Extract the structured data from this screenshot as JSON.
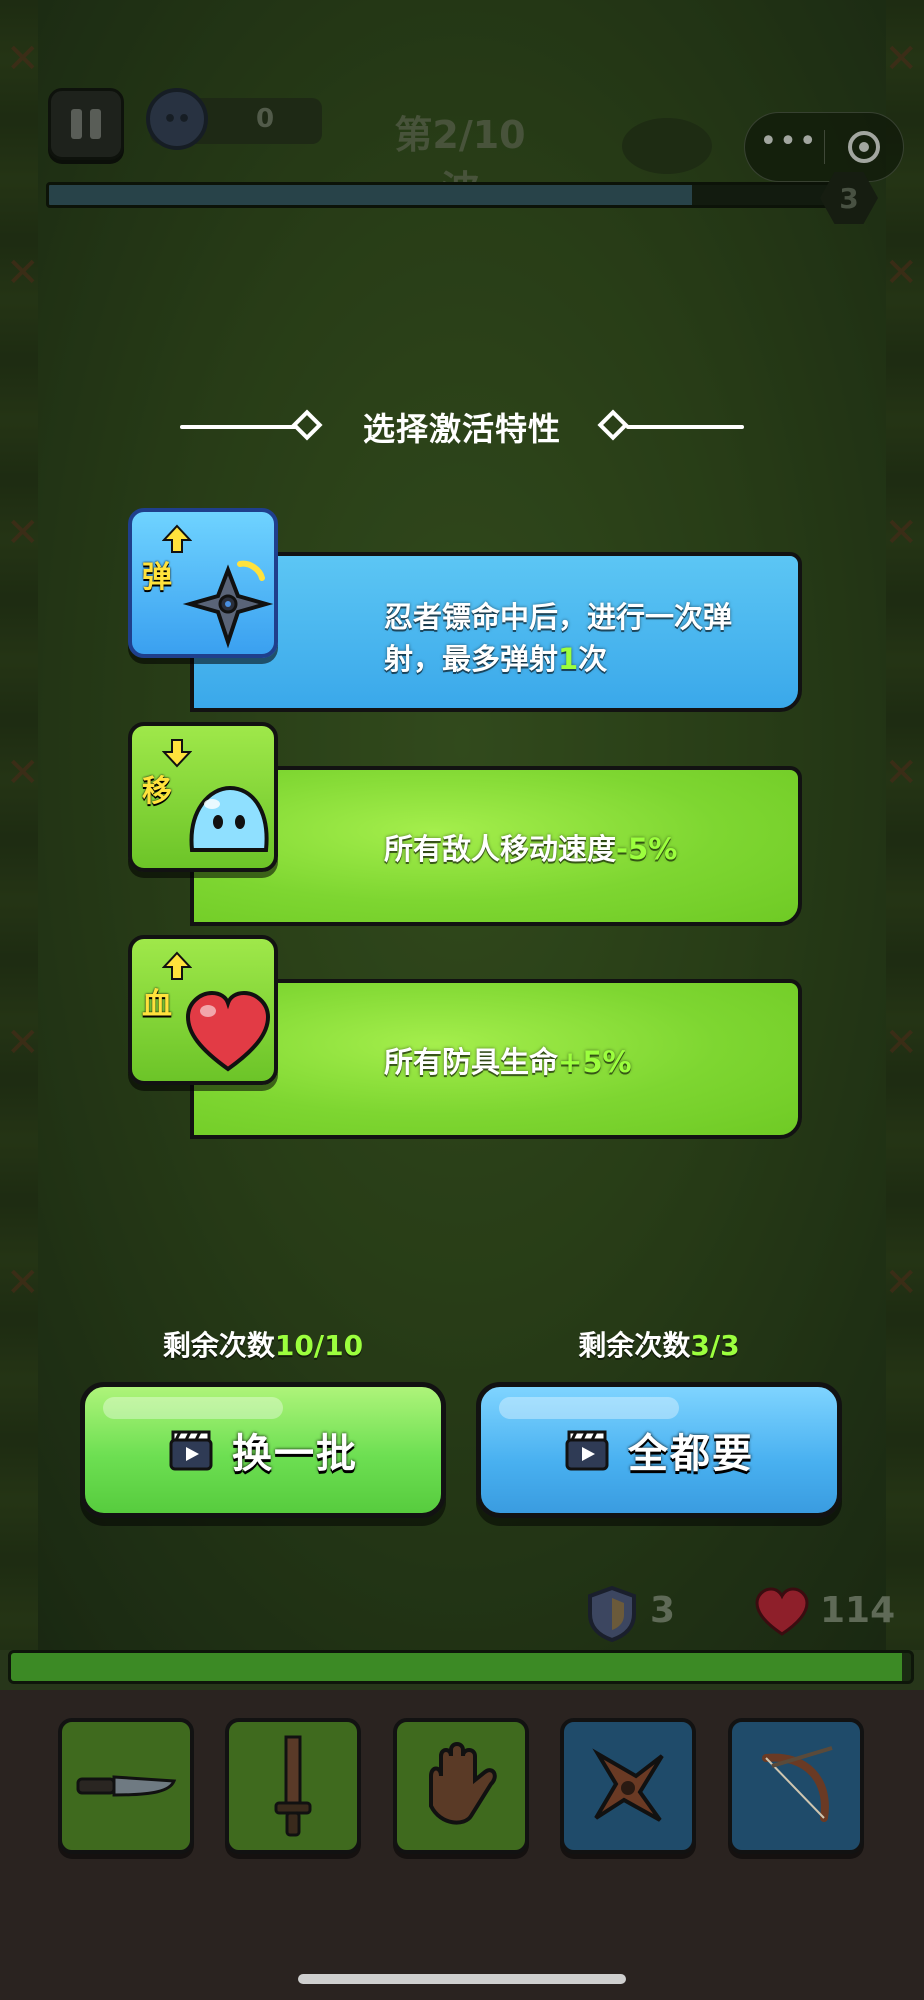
{
  "hud": {
    "coin_count": "0",
    "wave_label": "第2/10波",
    "wave_progress": 0.81,
    "wave_badge": "3"
  },
  "menu_capsule": {
    "more_label": "•••"
  },
  "trait_selection": {
    "title": "选择激活特性",
    "cards": [
      {
        "icon_char": "弹",
        "icon": "shuriken-icon",
        "desc_line1": "忍者镖命中后，进行一次弹",
        "desc_line2_pre": "射，最多弹射",
        "desc_line2_num": "1",
        "desc_line2_post": "次",
        "theme": "blue"
      },
      {
        "icon_char": "移",
        "icon": "slime-icon",
        "desc_pre": "所有敌人移动速度",
        "desc_num": "-5%",
        "theme": "green"
      },
      {
        "icon_char": "血",
        "icon": "heart-icon",
        "desc_pre": "所有防具生命",
        "desc_num": "+5%",
        "theme": "green"
      }
    ]
  },
  "actions": {
    "reroll": {
      "count_label": "剩余次数",
      "count_value": "10/10",
      "label": "换一批"
    },
    "take_all": {
      "count_label": "剩余次数",
      "count_value": "3/3",
      "label": "全都要"
    }
  },
  "player_stats": {
    "armor": "3",
    "hp": "114",
    "hp_fill": 0.99
  },
  "equipment_slots": [
    "knife-icon",
    "sword-icon",
    "glove-icon",
    "shuriken-icon",
    "bow-icon"
  ],
  "colors": {
    "accent_green": "#9cff3e",
    "card_blue": "#3aa8ea",
    "card_green": "#7ed631"
  }
}
